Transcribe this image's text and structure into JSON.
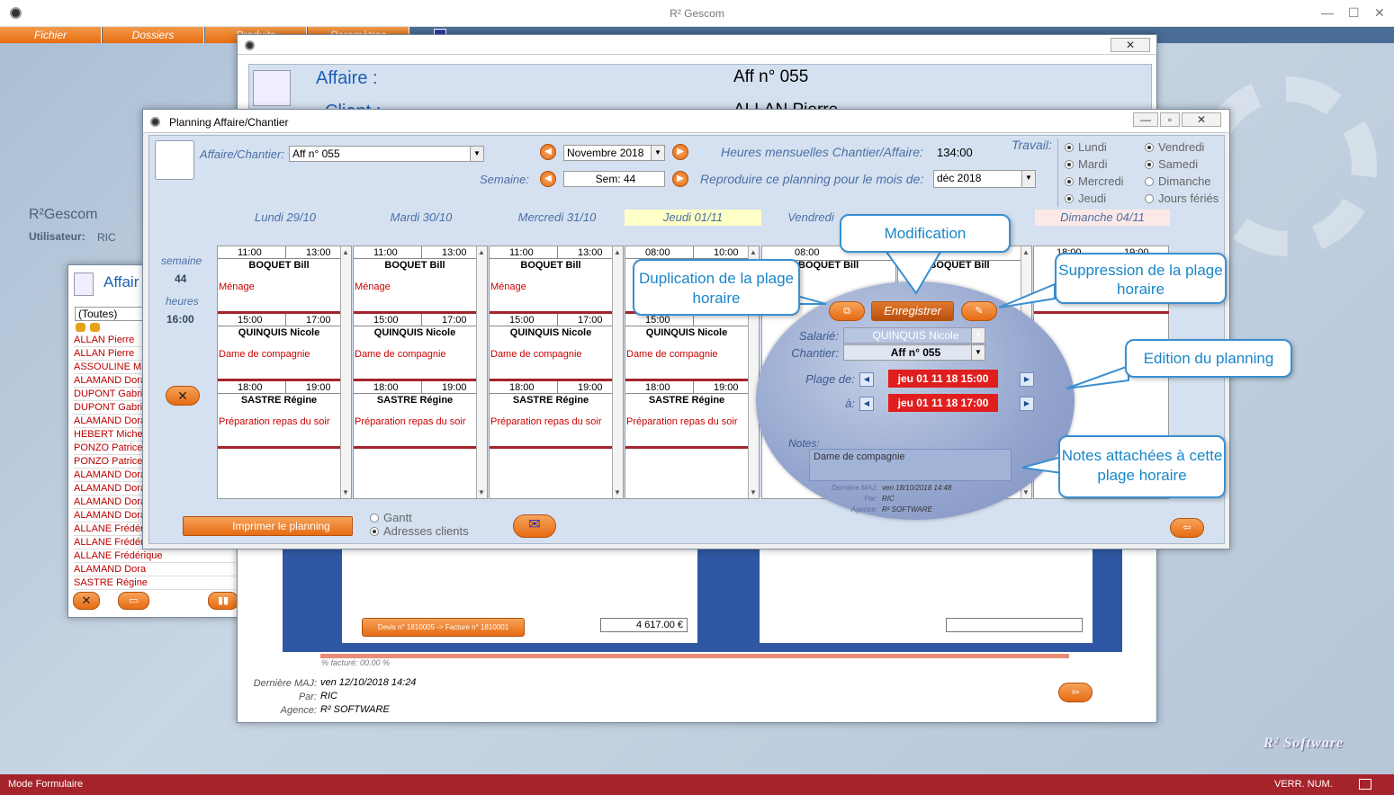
{
  "app": {
    "title": "R² Gescom",
    "brand": "R²Gescom",
    "user_label": "Utilisateur:",
    "user": "RIC",
    "footer_logo": "R² Software"
  },
  "menu": [
    "Fichier",
    "Dossiers",
    "Produits",
    "Paramètres"
  ],
  "status": {
    "mode": "Mode Formulaire",
    "num": "VERR. NUM."
  },
  "affaire_win": {
    "affaire_label": "Affaire :",
    "affaire_value": "Aff n° 055",
    "client_label": "Client :",
    "client_value": "ALLAN Pierre",
    "devis_button": "Devis n° 1810005 -> Facture n° 1810001",
    "amount": "4 617.00 €",
    "pct": "% facturé: 00.00 %",
    "last_update_label": "Dernière MAJ:",
    "last_update": "ven 12/10/2018 14:24",
    "par_label": "Par:",
    "par": "RIC",
    "agence_label": "Agence:",
    "agence": "R² SOFTWARE"
  },
  "list_win": {
    "title": "Affair",
    "filter": "(Toutes)",
    "items": [
      "ALLAN Pierre",
      "ALLAN Pierre",
      "ASSOULINE Ma",
      "ALAMAND Dora",
      "DUPONT Gabri",
      "DUPONT Gabri",
      "ALAMAND Dora",
      "HEBERT Miche",
      "PONZO Patrice",
      "PONZO Patrice",
      "ALAMAND Dora",
      "ALAMAND Dora",
      "ALAMAND Dora",
      "ALAMAND Dora",
      "ALLANE Frédér",
      "ALLANE Frédér",
      "ALLANE Frédérique",
      "ALAMAND Dora",
      "SASTRE Régine"
    ]
  },
  "planning": {
    "title": "Planning Affaire/Chantier",
    "affaire_label": "Affaire/Chantier:",
    "affaire_value": "Aff n° 055",
    "month": "Novembre 2018",
    "semaine_label": "Semaine:",
    "semaine_value": "Sem: 44",
    "heures_label": "Heures mensuelles Chantier/Affaire:",
    "heures_value": "134:00",
    "reproduire_label": "Reproduire ce planning pour le mois de:",
    "reproduire_value": "déc 2018",
    "travail_label": "Travail:",
    "jours": [
      {
        "label": "Lundi",
        "on": true
      },
      {
        "label": "Vendredi",
        "on": true
      },
      {
        "label": "Mardi",
        "on": true
      },
      {
        "label": "Samedi",
        "on": true
      },
      {
        "label": "Mercredi",
        "on": true
      },
      {
        "label": "Dimanche",
        "on": false
      },
      {
        "label": "Jeudi",
        "on": true
      },
      {
        "label": "Jours fériés",
        "on": false
      }
    ],
    "days": [
      "Lundi 29/10",
      "Mardi 30/10",
      "Mercredi 31/10",
      "Jeudi 01/11",
      "Vendredi",
      "Dimanche 04/11"
    ],
    "semaine_side_label": "semaine",
    "semaine_side_value": "44",
    "heures_side_label": "heures",
    "heures_side_value": "16:00",
    "slots": [
      [
        {
          "start": "11:00",
          "end": "13:00",
          "name": "BOQUET Bill",
          "task": "Ménage"
        },
        {
          "start": "15:00",
          "end": "17:00",
          "name": "QUINQUIS Nicole",
          "task": "Dame de compagnie"
        },
        {
          "start": "18:00",
          "end": "19:00",
          "name": "SASTRE Régine",
          "task": "Préparation repas du soir"
        }
      ],
      [
        {
          "start": "11:00",
          "end": "13:00",
          "name": "BOQUET Bill",
          "task": "Ménage"
        },
        {
          "start": "15:00",
          "end": "17:00",
          "name": "QUINQUIS Nicole",
          "task": "Dame de compagnie"
        },
        {
          "start": "18:00",
          "end": "19:00",
          "name": "SASTRE Régine",
          "task": "Préparation repas du soir"
        }
      ],
      [
        {
          "start": "11:00",
          "end": "13:00",
          "name": "BOQUET Bill",
          "task": "Ménage"
        },
        {
          "start": "15:00",
          "end": "17:00",
          "name": "QUINQUIS Nicole",
          "task": "Dame de compagnie"
        },
        {
          "start": "18:00",
          "end": "19:00",
          "name": "SASTRE Régine",
          "task": "Préparation repas du soir"
        }
      ],
      [
        {
          "start": "08:00",
          "end": "10:00",
          "name": "",
          "task": ""
        },
        {
          "start": "15:00",
          "end": "",
          "name": "QUINQUIS Nicole",
          "task": "Dame de compagnie"
        },
        {
          "start": "18:00",
          "end": "19:00",
          "name": "SASTRE Régine",
          "task": "Préparation repas du soir"
        }
      ]
    ],
    "col5": {
      "start": "08:00",
      "name": "BOQUET Bill"
    },
    "col6": {
      "name": "BOQUET Bill"
    },
    "col7": {
      "start": "18:00",
      "end": "19:00"
    },
    "print_button": "Imprimer le planning",
    "gantt": "Gantt",
    "adresses": "Adresses clients"
  },
  "editor": {
    "save": "Enregistrer",
    "salarie_label": "Salarié:",
    "salarie": "QUINQUIS Nicole",
    "chantier_label": "Chantier:",
    "chantier": "Aff n° 055",
    "plage_label": "Plage de:",
    "from": "jeu 01 11 18 15:00",
    "a_label": "à:",
    "to": "jeu 01 11 18 17:00",
    "notes_label": "Notes:",
    "notes": "Dame de compagnie",
    "maj_label": "Dernière MAJ:",
    "maj": "ven 18/10/2018 14:48",
    "par_label": "Par:",
    "par": "RIC",
    "agence_label": "Agence:",
    "agence": "R² SOFTWARE"
  },
  "callouts": {
    "modification": "Modification",
    "duplication": "Duplication de la plage horaire",
    "suppression": "Suppression de la plage horaire",
    "edition": "Edition du planning",
    "notes": "Notes attachées à cette plage horaire"
  },
  "colors": {
    "accent": "#e8731b",
    "status": "#a5232b",
    "callout": "#1a86c8"
  }
}
